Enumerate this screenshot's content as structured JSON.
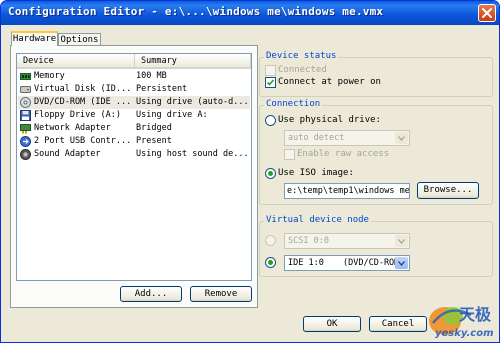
{
  "window": {
    "title": "Configuration Editor - e:\\...\\windows me\\windows me.vmx"
  },
  "tabs": [
    {
      "label": "Hardware"
    },
    {
      "label": "Options"
    }
  ],
  "device_list": {
    "columns": [
      "Device",
      "Summary"
    ],
    "rows": [
      {
        "device": "Memory",
        "summary": "100 MB",
        "icon": "memory-icon"
      },
      {
        "device": "Virtual Disk (ID...",
        "summary": "Persistent",
        "icon": "hard-disk-icon"
      },
      {
        "device": "DVD/CD-ROM (IDE ...",
        "summary": "Using drive (auto-d...",
        "icon": "cd-rom-icon",
        "selected": true
      },
      {
        "device": "Floppy Drive (A:)",
        "summary": "Using drive A:",
        "icon": "floppy-icon"
      },
      {
        "device": "Network Adapter",
        "summary": "Bridged",
        "icon": "network-icon"
      },
      {
        "device": "2 Port USB Contr...",
        "summary": "Present",
        "icon": "usb-icon"
      },
      {
        "device": "Sound Adapter",
        "summary": "Using host sound de...",
        "icon": "sound-icon"
      }
    ]
  },
  "buttons": {
    "add": "Add...",
    "remove": "Remove",
    "browse": "Browse...",
    "ok": "OK",
    "cancel": "Cancel"
  },
  "device_status": {
    "title": "Device status",
    "connected": {
      "label": "Connected",
      "checked": false,
      "disabled": true
    },
    "connect_at_power_on": {
      "label": "Connect at power on",
      "checked": true
    }
  },
  "connection": {
    "title": "Connection",
    "use_physical_drive": {
      "label": "Use physical drive:",
      "selected": false
    },
    "physical_drive_value": "auto detect",
    "enable_raw_access": {
      "label": "Enable raw access",
      "checked": false,
      "disabled": true
    },
    "use_iso_image": {
      "label": "Use ISO image:",
      "selected": true
    },
    "iso_path": "e:\\temp\\temp1\\windows me\\"
  },
  "virtual_device_node": {
    "title": "Virtual device node",
    "scsi": {
      "value": "SCSI 0:0",
      "selected": false
    },
    "ide": {
      "value": "IDE 1:0",
      "detail": "(DVD/CD-ROM)",
      "selected": true
    }
  },
  "watermark": {
    "text": "yesky.com",
    "brand": "天极"
  },
  "colors": {
    "titlebar": "#0a55d8",
    "group_title": "#0046d5",
    "close_button": "#d2471a",
    "radio_dot": "#21a121"
  }
}
